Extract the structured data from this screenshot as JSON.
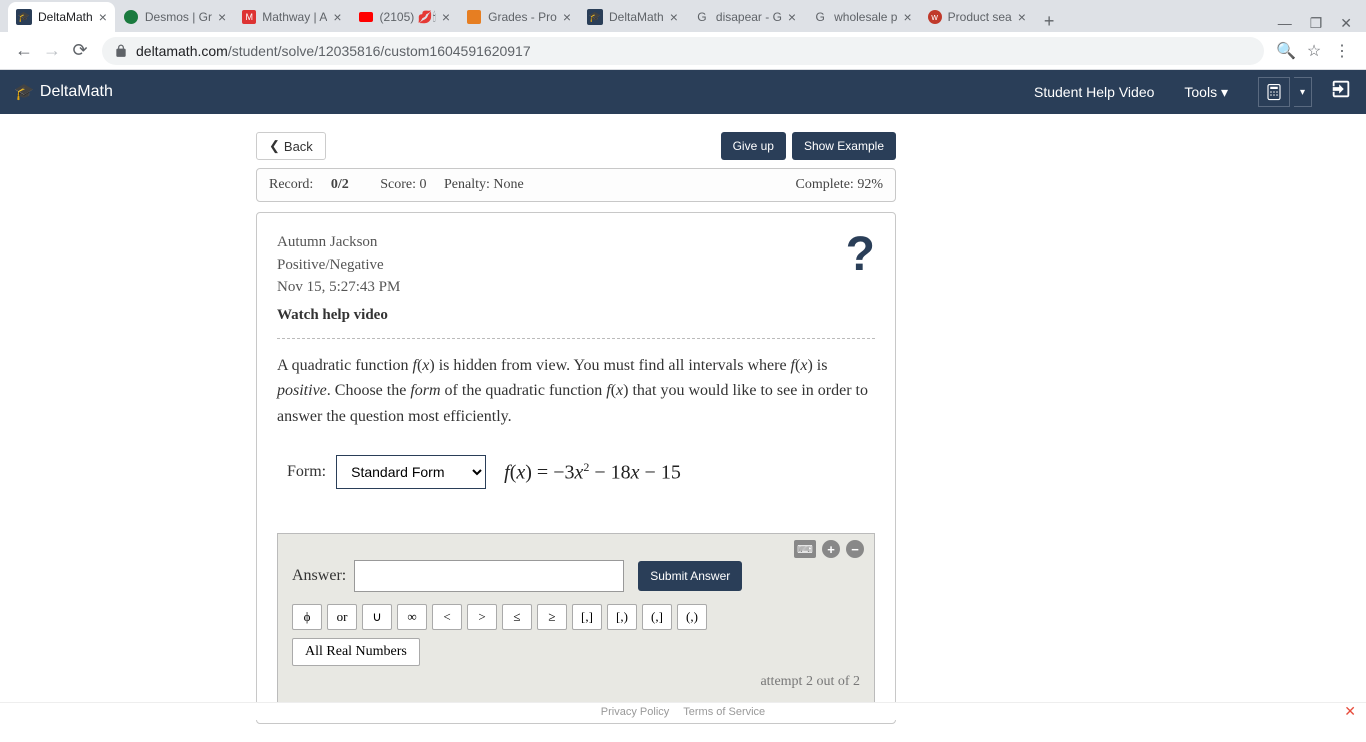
{
  "browser": {
    "tabs": [
      {
        "title": "DeltaMath",
        "active": true,
        "favicon": "deltamath"
      },
      {
        "title": "Desmos | Gr",
        "favicon": "desmos"
      },
      {
        "title": "Mathway | A",
        "favicon": "mathway"
      },
      {
        "title": "(2105) 💋🕯",
        "favicon": "youtube"
      },
      {
        "title": "Grades - Pro",
        "favicon": "hh"
      },
      {
        "title": "DeltaMath",
        "favicon": "deltamath"
      },
      {
        "title": "disapear - G",
        "favicon": "google"
      },
      {
        "title": "wholesale p",
        "favicon": "google"
      },
      {
        "title": "Product sea",
        "favicon": "w"
      }
    ],
    "url_domain": "deltamath.com",
    "url_path": "/student/solve/12035816/custom1604591620917"
  },
  "header": {
    "brand": "DeltaMath",
    "help_link": "Student Help Video",
    "tools_link": "Tools ▾"
  },
  "controls": {
    "back": "Back",
    "giveup": "Give up",
    "example": "Show Example"
  },
  "record": {
    "record_label": "Record: ",
    "record_value": "0/2",
    "score": "Score: 0",
    "penalty": "Penalty: None",
    "complete": "Complete: 92%"
  },
  "meta": {
    "student": "Autumn Jackson",
    "topic": "Positive/Negative",
    "timestamp": "Nov 15, 5:27:43 PM",
    "watch": "Watch help video"
  },
  "problem": {
    "text1": "A quadratic function ",
    "fx1": "f(x)",
    "text2": " is hidden from view. You must find all intervals where ",
    "fx2": "f(x)",
    "text3": " is ",
    "positive": "positive",
    "text4": ". Choose the ",
    "form_word": "form",
    "text5": " of the quadratic function ",
    "fx3": "f(x)",
    "text6": " that you would like to see in order to answer the question most efficiently."
  },
  "form": {
    "label": "Form:",
    "selected": "Standard Form",
    "equation": "f(x) = −3x² − 18x − 15"
  },
  "answer": {
    "label": "Answer:",
    "submit": "Submit Answer",
    "symbols": [
      "ϕ",
      "or",
      "∪",
      "∞",
      "<",
      ">",
      "≤",
      "≥",
      "[,]",
      "[,)",
      "(,]",
      "(,)"
    ],
    "allreal": "All Real Numbers",
    "attempt": "attempt 2 out of 2"
  },
  "footer": {
    "privacy": "Privacy Policy",
    "terms": "Terms of Service"
  }
}
